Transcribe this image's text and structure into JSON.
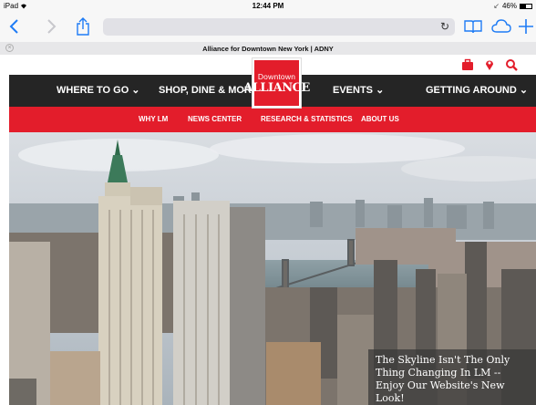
{
  "status_bar": {
    "device": "iPad",
    "time": "12:44 PM",
    "battery_text": "46%",
    "battery_level": 0.46
  },
  "browser": {
    "tab_title": "Alliance for Downtown New York | ADNY"
  },
  "logo": {
    "line1": "Downtown",
    "line2": "ALLIANCE"
  },
  "main_nav": {
    "items": [
      {
        "label": "WHERE TO GO ⌄"
      },
      {
        "label": "SHOP, DINE & MORE ⌄"
      },
      {
        "label": "EVENTS ⌄"
      },
      {
        "label": "GETTING AROUND ⌄"
      }
    ]
  },
  "sub_nav": {
    "items": [
      {
        "label": "WHY LM"
      },
      {
        "label": "NEWS CENTER"
      },
      {
        "label": "RESEARCH & STATISTICS"
      },
      {
        "label": "ABOUT US"
      }
    ]
  },
  "hero": {
    "caption": "The Skyline Isn't The Only Thing Changing In LM -- Enjoy Our Website's New Look!"
  },
  "colors": {
    "brand_red": "#e31d2b",
    "nav_dark": "#252525",
    "ios_blue": "#1f7cf5"
  },
  "icons": [
    "wifi-icon",
    "back-icon",
    "forward-icon",
    "share-icon",
    "reload-icon",
    "bookmarks-icon",
    "cloud-tabs-icon",
    "new-tab-icon",
    "close-tab-icon",
    "suitcase-icon",
    "map-pin-icon",
    "search-icon"
  ]
}
